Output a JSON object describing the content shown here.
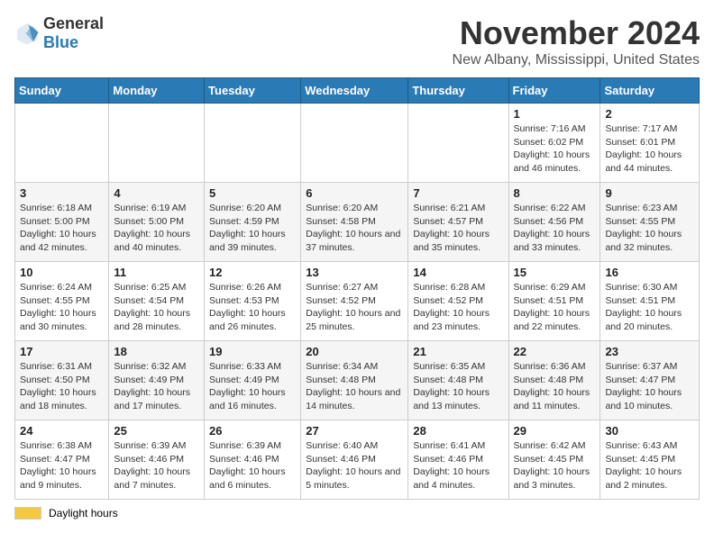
{
  "logo": {
    "general": "General",
    "blue": "Blue"
  },
  "title": "November 2024",
  "location": "New Albany, Mississippi, United States",
  "days_header": [
    "Sunday",
    "Monday",
    "Tuesday",
    "Wednesday",
    "Thursday",
    "Friday",
    "Saturday"
  ],
  "weeks": [
    [
      {
        "day": "",
        "info": ""
      },
      {
        "day": "",
        "info": ""
      },
      {
        "day": "",
        "info": ""
      },
      {
        "day": "",
        "info": ""
      },
      {
        "day": "",
        "info": ""
      },
      {
        "day": "1",
        "info": "Sunrise: 7:16 AM\nSunset: 6:02 PM\nDaylight: 10 hours and 46 minutes."
      },
      {
        "day": "2",
        "info": "Sunrise: 7:17 AM\nSunset: 6:01 PM\nDaylight: 10 hours and 44 minutes."
      }
    ],
    [
      {
        "day": "3",
        "info": "Sunrise: 6:18 AM\nSunset: 5:00 PM\nDaylight: 10 hours and 42 minutes."
      },
      {
        "day": "4",
        "info": "Sunrise: 6:19 AM\nSunset: 5:00 PM\nDaylight: 10 hours and 40 minutes."
      },
      {
        "day": "5",
        "info": "Sunrise: 6:20 AM\nSunset: 4:59 PM\nDaylight: 10 hours and 39 minutes."
      },
      {
        "day": "6",
        "info": "Sunrise: 6:20 AM\nSunset: 4:58 PM\nDaylight: 10 hours and 37 minutes."
      },
      {
        "day": "7",
        "info": "Sunrise: 6:21 AM\nSunset: 4:57 PM\nDaylight: 10 hours and 35 minutes."
      },
      {
        "day": "8",
        "info": "Sunrise: 6:22 AM\nSunset: 4:56 PM\nDaylight: 10 hours and 33 minutes."
      },
      {
        "day": "9",
        "info": "Sunrise: 6:23 AM\nSunset: 4:55 PM\nDaylight: 10 hours and 32 minutes."
      }
    ],
    [
      {
        "day": "10",
        "info": "Sunrise: 6:24 AM\nSunset: 4:55 PM\nDaylight: 10 hours and 30 minutes."
      },
      {
        "day": "11",
        "info": "Sunrise: 6:25 AM\nSunset: 4:54 PM\nDaylight: 10 hours and 28 minutes."
      },
      {
        "day": "12",
        "info": "Sunrise: 6:26 AM\nSunset: 4:53 PM\nDaylight: 10 hours and 26 minutes."
      },
      {
        "day": "13",
        "info": "Sunrise: 6:27 AM\nSunset: 4:52 PM\nDaylight: 10 hours and 25 minutes."
      },
      {
        "day": "14",
        "info": "Sunrise: 6:28 AM\nSunset: 4:52 PM\nDaylight: 10 hours and 23 minutes."
      },
      {
        "day": "15",
        "info": "Sunrise: 6:29 AM\nSunset: 4:51 PM\nDaylight: 10 hours and 22 minutes."
      },
      {
        "day": "16",
        "info": "Sunrise: 6:30 AM\nSunset: 4:51 PM\nDaylight: 10 hours and 20 minutes."
      }
    ],
    [
      {
        "day": "17",
        "info": "Sunrise: 6:31 AM\nSunset: 4:50 PM\nDaylight: 10 hours and 18 minutes."
      },
      {
        "day": "18",
        "info": "Sunrise: 6:32 AM\nSunset: 4:49 PM\nDaylight: 10 hours and 17 minutes."
      },
      {
        "day": "19",
        "info": "Sunrise: 6:33 AM\nSunset: 4:49 PM\nDaylight: 10 hours and 16 minutes."
      },
      {
        "day": "20",
        "info": "Sunrise: 6:34 AM\nSunset: 4:48 PM\nDaylight: 10 hours and 14 minutes."
      },
      {
        "day": "21",
        "info": "Sunrise: 6:35 AM\nSunset: 4:48 PM\nDaylight: 10 hours and 13 minutes."
      },
      {
        "day": "22",
        "info": "Sunrise: 6:36 AM\nSunset: 4:48 PM\nDaylight: 10 hours and 11 minutes."
      },
      {
        "day": "23",
        "info": "Sunrise: 6:37 AM\nSunset: 4:47 PM\nDaylight: 10 hours and 10 minutes."
      }
    ],
    [
      {
        "day": "24",
        "info": "Sunrise: 6:38 AM\nSunset: 4:47 PM\nDaylight: 10 hours and 9 minutes."
      },
      {
        "day": "25",
        "info": "Sunrise: 6:39 AM\nSunset: 4:46 PM\nDaylight: 10 hours and 7 minutes."
      },
      {
        "day": "26",
        "info": "Sunrise: 6:39 AM\nSunset: 4:46 PM\nDaylight: 10 hours and 6 minutes."
      },
      {
        "day": "27",
        "info": "Sunrise: 6:40 AM\nSunset: 4:46 PM\nDaylight: 10 hours and 5 minutes."
      },
      {
        "day": "28",
        "info": "Sunrise: 6:41 AM\nSunset: 4:46 PM\nDaylight: 10 hours and 4 minutes."
      },
      {
        "day": "29",
        "info": "Sunrise: 6:42 AM\nSunset: 4:45 PM\nDaylight: 10 hours and 3 minutes."
      },
      {
        "day": "30",
        "info": "Sunrise: 6:43 AM\nSunset: 4:45 PM\nDaylight: 10 hours and 2 minutes."
      }
    ]
  ],
  "legend": {
    "daylight_label": "Daylight hours",
    "daylight_color": "#f5c842"
  }
}
